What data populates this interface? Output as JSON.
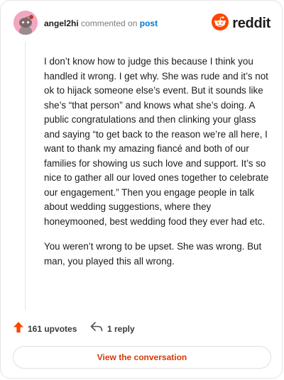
{
  "header": {
    "username": "angel2hi",
    "action_text": "commented on",
    "post_link": "post",
    "brand": "reddit"
  },
  "comment": {
    "paragraphs": [
      "I don’t know how to judge this because I think you handled it wrong. I get why. She was rude and it’s not ok to hijack someone else’s event. But it sounds like she’s “that person” and knows what she’s doing. A public congratulations and then clinking your glass and saying “to get back to the reason we’re all here, I want to thank my amazing fiancé and both of our families for showing us such love and support. It’s so nice to gather all our loved ones together to celebrate our engagement.” Then you engage people in talk about wedding suggestions, where they honeymooned, best wedding food they ever had etc.",
      "You weren’t wrong to be upset. She was wrong. But man, you played this all wrong."
    ]
  },
  "actions": {
    "upvotes": "161 upvotes",
    "replies": "1 reply",
    "view_button": "View the conversation"
  },
  "colors": {
    "accent": "#ff4500",
    "link": "#0079d3",
    "button_text": "#d93900",
    "avatar_bg": "#f3a6c0"
  },
  "icons": {
    "avatar": "snoo-avatar-icon",
    "brand": "reddit-logo-icon",
    "upvote": "upvote-arrow-icon",
    "reply": "reply-arrow-icon"
  }
}
